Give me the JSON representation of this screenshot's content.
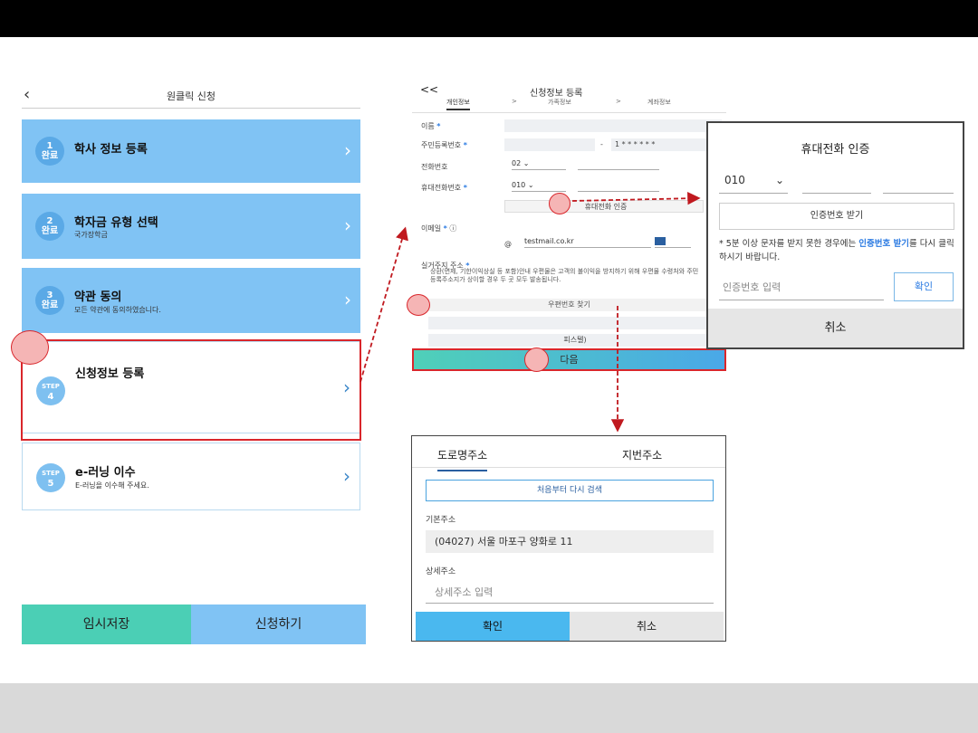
{
  "left_panel": {
    "title": "원클릭 신청",
    "steps": [
      {
        "num": "1",
        "status": "완료",
        "title": "학사 정보 등록",
        "sub": ""
      },
      {
        "num": "2",
        "status": "완료",
        "title": "학자금 유형 선택",
        "sub": "국가장학금"
      },
      {
        "num": "3",
        "status": "완료",
        "title": "약관 동의",
        "sub": "모든 약관에 동의하였습니다."
      },
      {
        "num": "4",
        "status": "STEP",
        "title": "신청정보 등록",
        "sub": ""
      },
      {
        "num": "5",
        "status": "STEP",
        "title": "e-러닝 이수",
        "sub": "E-러닝을 이수해 주세요."
      }
    ],
    "save_label": "임시저장",
    "apply_label": "신청하기"
  },
  "form_panel": {
    "back": "<<",
    "title": "신청정보 등록",
    "tabs": [
      "개인정보",
      ">",
      "가족정보",
      ">",
      "계좌정보"
    ],
    "name_label": "이름",
    "rrn_label": "주민등록번호",
    "rrn_dash": "-",
    "rrn_back": "1 * * * * * *",
    "phone_label": "전화번호",
    "phone_prefix": "02",
    "mobile_label": "휴대전화번호",
    "mobile_prefix": "010",
    "mobile_verify": "휴대전화 인증",
    "email_label": "이메일",
    "email_value": "testmail.co.kr",
    "email_at": "@",
    "address_label": "실거주지 주소",
    "address_note": "상환(면제, 기한이익상실 등 포함)안내 우편물은 고객의 불이익을 방지하기 위해 우편물 수령처와 주민등록주소지가 상이할 경우 두 곳 모두 발송됩니다.",
    "postcode_button": "우편번호 찾기",
    "addr_fragment": "피스텔)",
    "next_label": "다음"
  },
  "phone_popup": {
    "title": "휴대전화 인증",
    "carrier": "010",
    "get_code": "인증번호 받기",
    "note_prefix": "* 5분 이상 문자를 받지 못한 경우에는 ",
    "note_highlight": "인증번호 받기",
    "note_suffix": "를 다시 클릭하시기 바랍니다.",
    "code_placeholder": "인증번호 입력",
    "confirm": "확인",
    "cancel": "취소"
  },
  "address_popup": {
    "tab_road": "도로명주소",
    "tab_lot": "지번주소",
    "research": "처음부터 다시 검색",
    "base_label": "기본주소",
    "base_value": "(04027) 서울 마포구 양화로 11",
    "detail_label": "상세주소",
    "detail_placeholder": "상세주소 입력",
    "confirm": "확인",
    "cancel": "취소"
  },
  "colors": {
    "step_complete": "#80c3f4",
    "highlight": "#d9262b",
    "save": "#4bcfb5"
  }
}
